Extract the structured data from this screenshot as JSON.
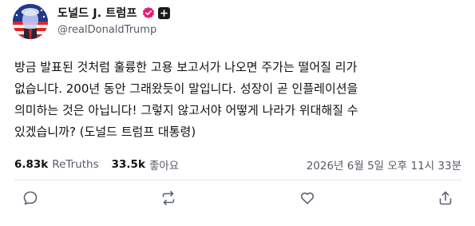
{
  "author": {
    "display_name": "도널드 J. 트럼프",
    "handle": "@realDonaldTrump"
  },
  "post": {
    "text": "방금 발표된 것처럼 훌륭한 고용 보고서가 나오면 주가는 떨어질 리가\n없습니다. 200년 동안 그래왔듯이 말입니다. 성장이 곧 인플레이션을\n의미하는 것은 아닙니다! 그렇지 않고서야 어떻게 나라가 위대해질 수\n있겠습니까? (도널드 트럼프 대통령)"
  },
  "stats": {
    "retruths_count": "6.83k",
    "retruths_label": "ReTruths",
    "likes_count": "33.5k",
    "likes_label": "좋아요",
    "timestamp": "2026년 6월 5일 오후 11시 33분"
  },
  "icons": {
    "verified": "verified-check-icon",
    "plus": "plus-icon",
    "reply": "reply-icon",
    "retruth": "retruth-icon",
    "like": "heart-icon",
    "share": "share-icon"
  },
  "colors": {
    "verified_badge": "#e11d74",
    "muted_text": "#555b66",
    "icon": "#5b6270"
  }
}
